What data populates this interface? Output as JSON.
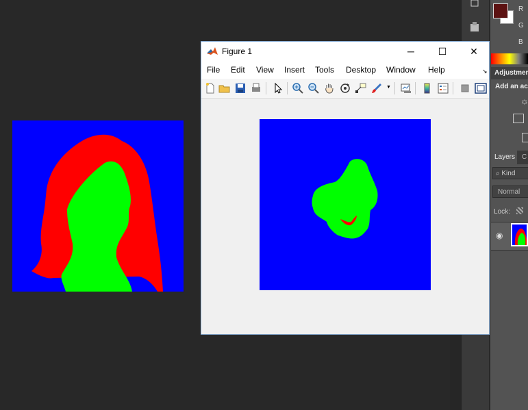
{
  "figure_window": {
    "title": "Figure 1",
    "controls": {
      "minimize": "─",
      "maximize": "☐",
      "close": "✕"
    },
    "menu": [
      "File",
      "Edit",
      "View",
      "Insert",
      "Tools",
      "Desktop",
      "Window",
      "Help"
    ],
    "menu_corner": "↘",
    "toolbar": [
      "new-figure",
      "open-file",
      "save",
      "print",
      "edit-plot-arrow",
      "zoom-in",
      "zoom-out",
      "pan",
      "rotate-3d",
      "data-cursor",
      "brush",
      "link-plot",
      "colorbar",
      "legend",
      "hide-plot-tools",
      "show-plot-tools"
    ]
  },
  "canvas_image": {
    "description_colors": {
      "background": "#0000ff",
      "hair": "#ff0000",
      "face": "#00ff00"
    }
  },
  "figure_image": {
    "description_colors": {
      "background": "#0000ff",
      "face": "#00ff00",
      "mouth": "#ff0000"
    }
  },
  "photoshop": {
    "channels": [
      "R",
      "G",
      "B"
    ],
    "foreground_color": "#5c1212",
    "background_color": "#ffffff",
    "adjustments_tab": "Adjustmen",
    "add_adjustment": "Add an ac",
    "layers_tab": "Layers",
    "channels_tab": "C",
    "kind_filter": "Kind",
    "blend_mode": "Normal",
    "lock_label": "Lock:"
  }
}
